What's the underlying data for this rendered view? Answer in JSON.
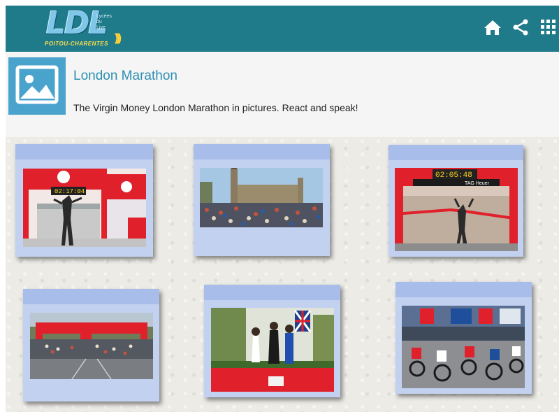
{
  "app": {
    "logo_main": "LDL",
    "logo_tagline": [
      "Lycées",
      "du",
      "Live"
    ],
    "logo_region": "POITOU-CHARENTES"
  },
  "toolbar": {
    "icons": [
      "home-icon",
      "share-icon",
      "apps-grid-icon"
    ]
  },
  "album": {
    "title": "London Marathon",
    "description": "The Virgin Money London Marathon in pictures. React and speak!"
  },
  "colors": {
    "topbar": "#1f7a8a",
    "title": "#2c8fb0",
    "card": "#c3d1f1",
    "virgin_red": "#e0202b"
  },
  "photos": [
    {
      "id": "photo-1",
      "clock": "02:17:04",
      "subject": "finish-line-runner"
    },
    {
      "id": "photo-2",
      "subject": "crowd-big-ben"
    },
    {
      "id": "photo-3",
      "clock": "02:05:48",
      "banner": "TAG Heuer",
      "subject": "winner-tape"
    },
    {
      "id": "photo-4",
      "subject": "start-line"
    },
    {
      "id": "photo-5",
      "subject": "podium"
    },
    {
      "id": "photo-6",
      "subject": "wheelchair-race"
    }
  ]
}
